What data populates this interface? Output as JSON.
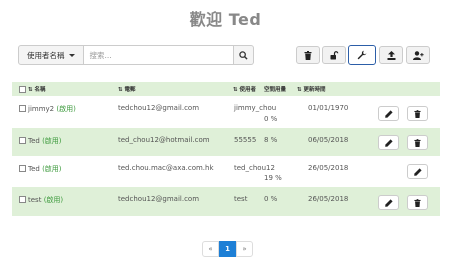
{
  "header": {
    "title": "歡迎 Ted"
  },
  "search": {
    "filter_label": "使用者名稱",
    "placeholder": "搜索..."
  },
  "toolbar": {
    "buttons": [
      {
        "icon": "trash-icon"
      },
      {
        "icon": "unlock-icon"
      },
      {
        "icon": "wrench-icon",
        "active": true
      },
      {
        "icon": "upload-icon"
      },
      {
        "icon": "add-user-icon"
      }
    ]
  },
  "table": {
    "columns": [
      "名稱",
      "電郵",
      "使用者",
      "空間用量",
      "更新時間"
    ],
    "rows": [
      {
        "name": "jimmy2",
        "status": "(啟用)",
        "email": "tedchou12@gmail.com",
        "user": "jimmy_chou",
        "usage": "0 %",
        "updated": "01/01/1970",
        "actions": [
          "edit",
          "delete"
        ]
      },
      {
        "name": "Ted",
        "status": "(啟用)",
        "email": "ted_chou12@hotmail.com",
        "user": "55555",
        "usage": "8 %",
        "updated": "06/05/2018",
        "actions": [
          "edit",
          "delete"
        ]
      },
      {
        "name": "Ted",
        "status": "(啟用)",
        "email": "ted.chou.mac@axa.com.hk",
        "user": "ted_chou12",
        "usage": "19 %",
        "updated": "26/05/2018",
        "actions": [
          "edit"
        ]
      },
      {
        "name": "test",
        "status": "(啟用)",
        "email": "tedchou12@gmail.com",
        "user": "test",
        "usage": "0 %",
        "updated": "26/05/2018",
        "actions": [
          "edit",
          "delete"
        ]
      }
    ]
  },
  "pagination": {
    "prev": "«",
    "current": "1",
    "next": "»"
  }
}
